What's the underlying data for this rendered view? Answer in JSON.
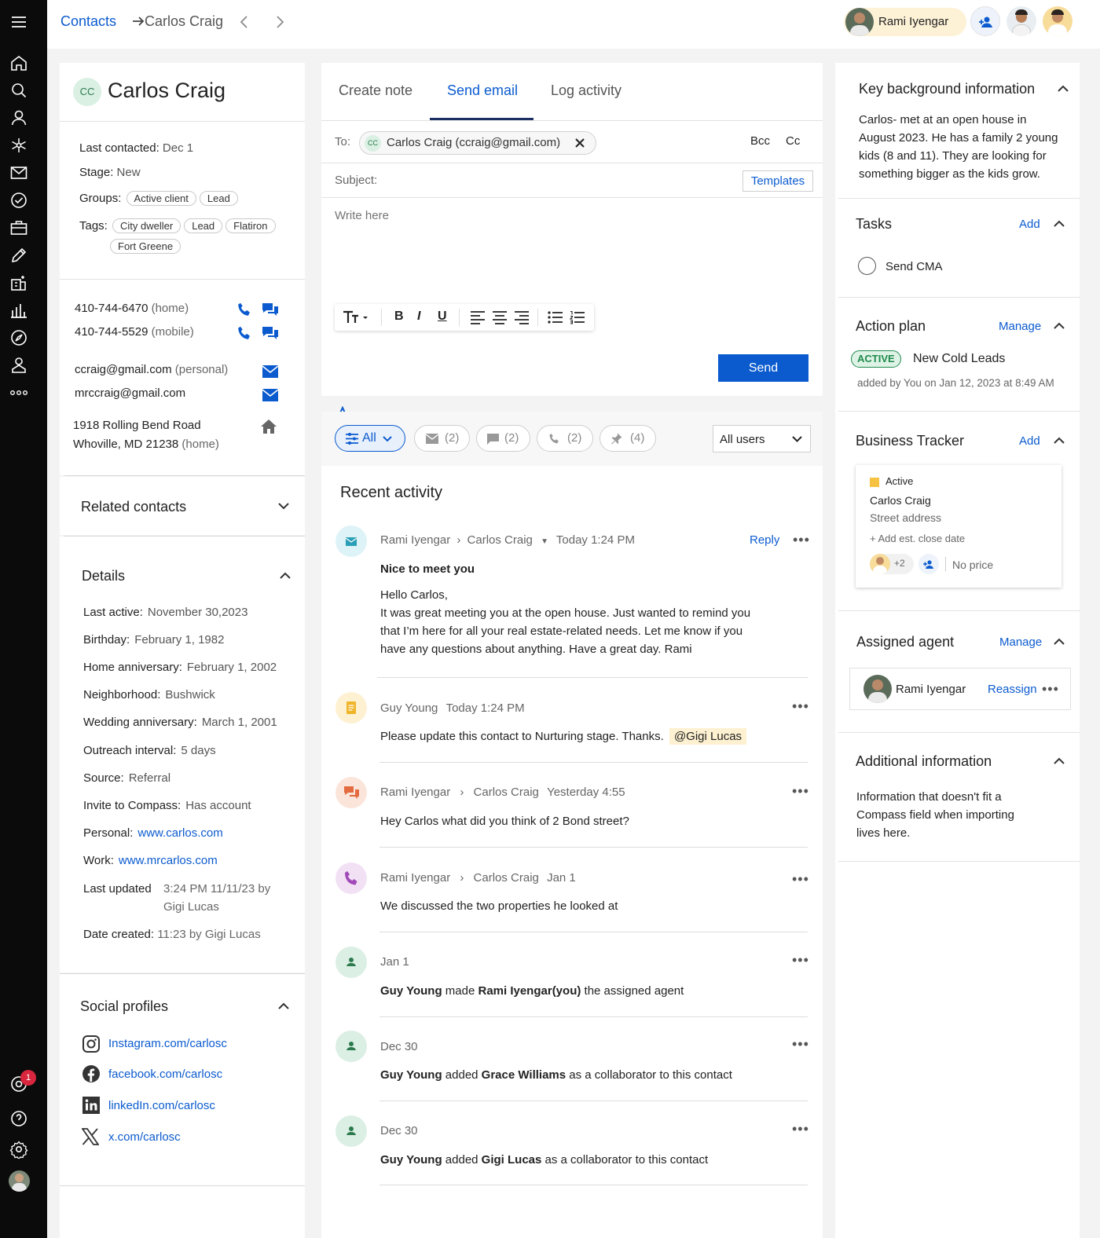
{
  "breadcrumb": {
    "parent": "Contacts",
    "current": "Carlos Craig"
  },
  "topbar": {
    "user_name": "Rami Iyengar"
  },
  "nav": {
    "notification_count": "1"
  },
  "contact": {
    "initials": "CC",
    "name": "Carlos Craig",
    "last_contacted_label": "Last contacted:",
    "last_contacted": "Dec 1",
    "stage_label": "Stage:",
    "stage": "New",
    "groups_label": "Groups:",
    "groups": [
      "Active client",
      "Lead"
    ],
    "tags_label": "Tags:",
    "tags": [
      "City dweller",
      "Lead",
      "Flatiron",
      "Fort Greene"
    ],
    "phone1": "410-744-6470",
    "phone1_type": "(home)",
    "phone2": "410-744-5529",
    "phone2_type": "(mobile)",
    "email1": "ccraig@gmail.com",
    "email1_type": "(personal)",
    "email2": "mrccraig@gmail.com",
    "address1": "1918 Rolling Bend Road",
    "address2": "Whoville, MD 21238",
    "address_type": "(home)"
  },
  "related": {
    "title": "Related contacts"
  },
  "details": {
    "title": "Details",
    "rows": [
      {
        "label": "Last active:",
        "value": "November 30,2023"
      },
      {
        "label": "Birthday:",
        "value": "February 1, 1982"
      },
      {
        "label": "Home anniversary:",
        "value": "February 1, 2002"
      },
      {
        "label": "Neighborhood:",
        "value": "Bushwick"
      },
      {
        "label": "Wedding anniversary:",
        "value": "March 1, 2001"
      },
      {
        "label": "Outreach interval:",
        "value": "5 days"
      },
      {
        "label": "Source:",
        "value": "Referral"
      },
      {
        "label": "Invite to Compass:",
        "value": "Has account"
      },
      {
        "label": "Personal:",
        "value": "www.carlos.com"
      },
      {
        "label": "Work:",
        "value": "www.mrcarlos.com"
      }
    ],
    "last_updated_label": "Last updated",
    "last_updated_1": "3:24 PM 11/11/23 by",
    "last_updated_2": "Gigi Lucas",
    "date_created_label": "Date created:",
    "date_created": "11:23 by Gigi Lucas"
  },
  "social": {
    "title": "Social profiles",
    "instagram": "Instagram.com/carlosc",
    "facebook": "facebook.com/carlosc",
    "linkedin": "linkedIn.com/carlosc",
    "x": "x.com/carlosc"
  },
  "composer": {
    "tabs": [
      "Create note",
      "Send email",
      "Log activity"
    ],
    "to_label": "To:",
    "recipient_initials": "CC",
    "recipient": "Carlos Craig (ccraig@gmail.com)",
    "bcc": "Bcc",
    "cc": "Cc",
    "subject_label": "Subject:",
    "templates": "Templates",
    "body_placeholder": "Write here",
    "send": "Send"
  },
  "filters": {
    "all": "All",
    "email_count": "(2)",
    "note_count": "(2)",
    "call_count": "(2)",
    "pin_count": "(4)",
    "users": "All users"
  },
  "activity": {
    "title": "Recent activity",
    "email": {
      "from": "Rami Iyengar",
      "to": "Carlos Craig",
      "time": "Today 1:24 PM",
      "reply": "Reply",
      "subject": "Nice to meet you",
      "greeting": "Hello Carlos,",
      "line1": "It was great meeting you at the open house. Just wanted to remind you",
      "line2": "that I’m here for all your real estate-related needs. Let me know if you",
      "line3": "have any questions about anything. Have a great day. Rami"
    },
    "note": {
      "from": "Guy Young",
      "time": "Today 1:24 PM",
      "text": "Please update this contact to Nurturing stage. Thanks.",
      "mention": "@Gigi Lucas"
    },
    "text": {
      "from": "Rami Iyengar",
      "to": "Carlos Craig",
      "time": "Yesterday 4:55",
      "text": "Hey Carlos what did you think of 2 Bond street?"
    },
    "call": {
      "from": "Rami Iyengar",
      "to": "Carlos Craig",
      "time": "Jan 1",
      "text": "We discussed the two properties he looked at"
    },
    "agent": {
      "time": "Jan 1",
      "actor": "Guy Young",
      "verb": " made ",
      "target": "Rami Iyengar(you)",
      "rest": " the assigned agent"
    },
    "collab1": {
      "time": "Dec 30",
      "actor": "Guy Young",
      "verb": " added ",
      "target": "Grace Williams",
      "rest": " as a collaborator to this contact"
    },
    "collab2": {
      "time": "Dec 30",
      "actor": "Guy Young",
      "verb": " added ",
      "target": "Gigi Lucas",
      "rest": " as a collaborator to this contact"
    }
  },
  "right": {
    "background_title": "Key background information",
    "background_lines": [
      "Carlos- met at an open house in",
      "August 2023. He has a family 2 young",
      "kids (8 and 11). They are looking for",
      "something bigger as the kids grow."
    ],
    "tasks_title": "Tasks",
    "tasks_add": "Add",
    "task1": "Send CMA",
    "plan_title": "Action plan",
    "plan_manage": "Manage",
    "plan_status": "ACTIVE",
    "plan_name": "New Cold Leads",
    "plan_meta": "added by You on Jan 12, 2023 at 8:49 AM",
    "tracker_title": "Business Tracker",
    "tracker_add": "Add",
    "tracker_status": "Active",
    "tracker_name": "Carlos Craig",
    "tracker_addr": "Street address",
    "tracker_close": "+ Add est. close date",
    "tracker_more": "+2",
    "tracker_price": "No price",
    "agent_title": "Assigned agent",
    "agent_manage": "Manage",
    "agent_name": "Rami Iyengar",
    "agent_reassign": "Reassign",
    "addl_title": "Additional information",
    "addl_lines": [
      "Information that doesn't fit a",
      "Compass field when importing",
      "lives here."
    ]
  },
  "colors": {
    "accent": "#0b5bcf",
    "nav_bg": "#0b0b0b",
    "active_green": "#1f8a4c",
    "note_yellow": "#f5c242"
  }
}
